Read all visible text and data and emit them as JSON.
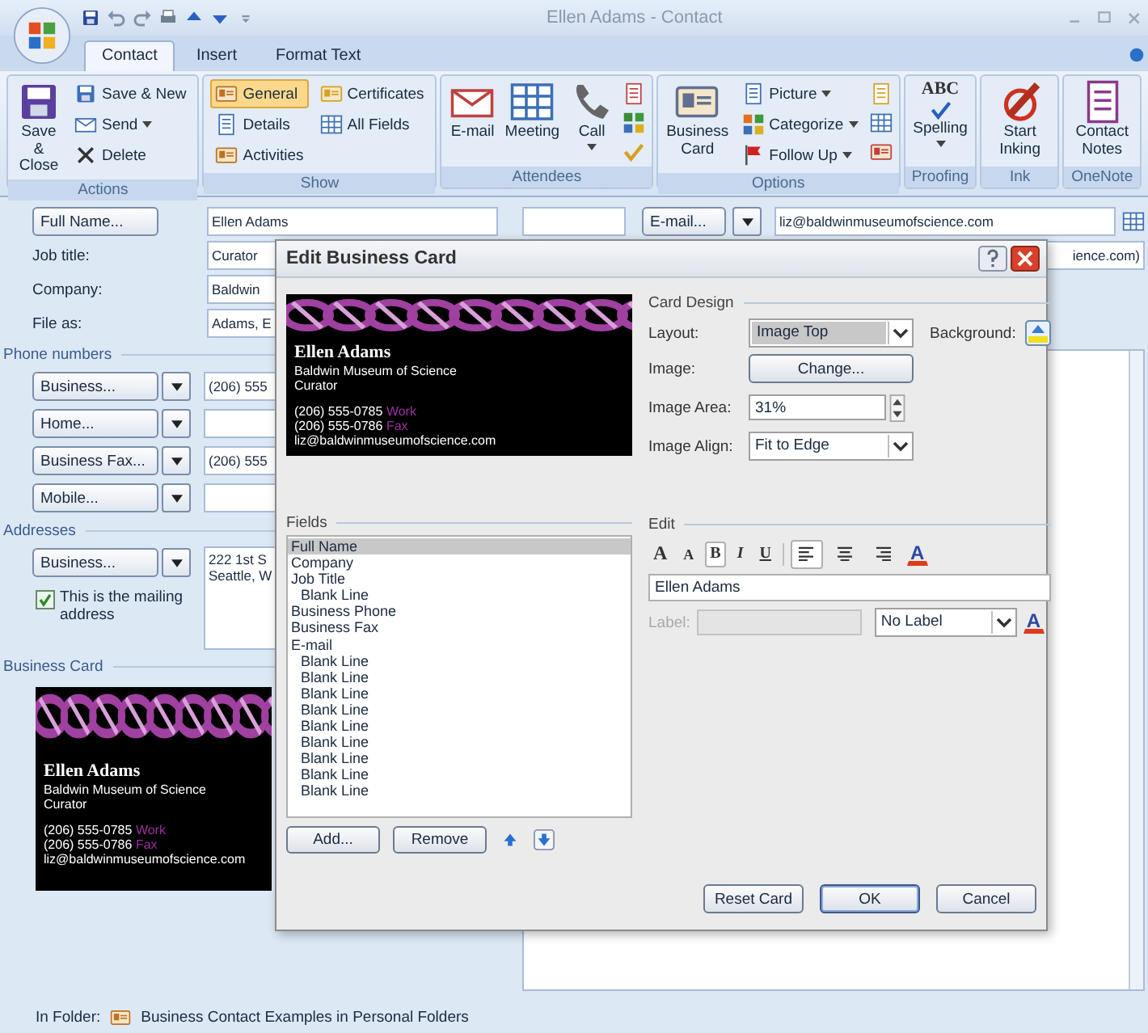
{
  "window": {
    "title": "Ellen Adams - Contact"
  },
  "tabs": [
    {
      "label": "Contact",
      "selected": true
    },
    {
      "label": "Insert",
      "selected": false
    },
    {
      "label": "Format Text",
      "selected": false
    }
  ],
  "ribbon": {
    "groups": [
      {
        "label": "Actions",
        "columns": [
          {
            "kind": "large",
            "items": [
              {
                "label": "Save & Close",
                "dropdown": false
              }
            ]
          },
          {
            "kind": "stack",
            "items": [
              {
                "label": "Save & New",
                "dropdown": false
              },
              {
                "label": "Send",
                "dropdown": true
              },
              {
                "label": "Delete",
                "dropdown": false
              }
            ]
          }
        ]
      },
      {
        "label": "Show",
        "columns": [
          {
            "kind": "stack",
            "items": [
              {
                "label": "General",
                "dropdown": false,
                "selected": true
              },
              {
                "label": "Details",
                "dropdown": false,
                "selected": false
              },
              {
                "label": "Activities",
                "dropdown": false,
                "selected": false
              }
            ]
          },
          {
            "kind": "stack",
            "items": [
              {
                "label": "Certificates",
                "dropdown": false,
                "selected": false
              },
              {
                "label": "All Fields",
                "dropdown": false,
                "selected": false
              }
            ]
          }
        ]
      },
      {
        "label": "Attendees",
        "columns": [
          {
            "kind": "large",
            "items": [
              {
                "label": "E-mail",
                "dropdown": false
              }
            ]
          },
          {
            "kind": "large",
            "items": [
              {
                "label": "Meeting",
                "dropdown": false
              }
            ]
          },
          {
            "kind": "large",
            "items": [
              {
                "label": "Call",
                "dropdown": true
              }
            ]
          },
          {
            "kind": "icons"
          }
        ]
      },
      {
        "label": "Options",
        "columns": [
          {
            "kind": "large",
            "items": [
              {
                "label": "Business Card",
                "dropdown": false
              }
            ]
          },
          {
            "kind": "stack",
            "items": [
              {
                "label": "Picture",
                "dropdown": true
              },
              {
                "label": "Categorize",
                "dropdown": true
              },
              {
                "label": "Follow Up",
                "dropdown": true
              }
            ]
          },
          {
            "kind": "icons"
          }
        ]
      },
      {
        "label": "Proofing",
        "columns": [
          {
            "kind": "large",
            "items": [
              {
                "label": "Spelling",
                "dropdown": true,
                "icon_text": "ABC"
              }
            ]
          }
        ]
      },
      {
        "label": "Ink",
        "columns": [
          {
            "kind": "large",
            "items": [
              {
                "label": "Start Inking",
                "dropdown": false
              }
            ]
          }
        ]
      },
      {
        "label": "OneNote",
        "columns": [
          {
            "kind": "large",
            "items": [
              {
                "label": "Contact Notes",
                "dropdown": false
              }
            ]
          }
        ]
      }
    ]
  },
  "contact_form": {
    "name_button": "Full Name...",
    "name_value": "Ellen Adams",
    "fields": [
      {
        "label": "Job title:",
        "value": "Curator"
      },
      {
        "label": "Company:",
        "value": "Baldwin"
      },
      {
        "label": "File as:",
        "value": "Adams, E"
      }
    ],
    "phone_heading": "Phone numbers",
    "phones": [
      {
        "button": "Business...",
        "value": "(206) 555"
      },
      {
        "button": "Home..."
      },
      {
        "button": "Business Fax...",
        "value": "(206) 555"
      },
      {
        "button": "Mobile..."
      }
    ],
    "addresses_heading": "Addresses",
    "address_button": "Business...",
    "address_lines": [
      "222 1st S",
      "Seattle, W"
    ],
    "mailing_checkbox": {
      "label": "This is the mailing address",
      "checked": true
    },
    "card_heading": "Business Card",
    "card": {
      "name": "Ellen Adams",
      "company": "Baldwin Museum of Science",
      "title": "Curator",
      "phones": [
        {
          "number": "(206) 555-0785",
          "label": "Work"
        },
        {
          "number": "(206) 555-0786",
          "label": "Fax"
        }
      ],
      "email": "liz@baldwinmuseumofscience.com"
    },
    "email_button": "E-mail...",
    "email_value": "liz@baldwinmuseumofscience.com",
    "display_as": "ience.com)"
  },
  "dialog": {
    "title": "Edit Business Card",
    "card": {
      "name": "Ellen Adams",
      "company": "Baldwin Museum of Science",
      "title": "Curator",
      "phones": [
        {
          "number": "(206) 555-0785",
          "label": "Work"
        },
        {
          "number": "(206) 555-0786",
          "label": "Fax"
        }
      ],
      "email": "liz@baldwinmuseumofscience.com"
    },
    "card_design_heading": "Card Design",
    "layout_label": "Layout:",
    "layout_value": "Image Top",
    "background_label": "Background:",
    "image_label": "Image:",
    "change_button": "Change...",
    "image_area_label": "Image Area:",
    "image_area_value": "31%",
    "image_align_label": "Image Align:",
    "image_align_value": "Fit to Edge",
    "fields_heading": "Fields",
    "fields": [
      {
        "label": "Full Name",
        "selected": true
      },
      {
        "label": "Company",
        "selected": false
      },
      {
        "label": "Job Title",
        "selected": false,
        "children": [
          {
            "label": "Blank Line",
            "selected": false
          }
        ]
      },
      {
        "label": "Business Phone",
        "selected": false
      },
      {
        "label": "Business Fax",
        "selected": false
      },
      {
        "label": "E-mail",
        "selected": false,
        "children": [
          {
            "label": "Blank Line",
            "selected": false
          },
          {
            "label": "Blank Line",
            "selected": false
          },
          {
            "label": "Blank Line",
            "selected": false
          },
          {
            "label": "Blank Line",
            "selected": false
          },
          {
            "label": "Blank Line",
            "selected": false
          },
          {
            "label": "Blank Line",
            "selected": false
          },
          {
            "label": "Blank Line",
            "selected": false
          },
          {
            "label": "Blank Line",
            "selected": false
          },
          {
            "label": "Blank Line",
            "selected": false
          }
        ]
      }
    ],
    "add_button": "Add...",
    "remove_button": "Remove",
    "edit_heading": "Edit",
    "font_size_buttons": [
      "A",
      "A"
    ],
    "style_buttons": [
      {
        "label": "B",
        "selected": true
      },
      {
        "label": "I",
        "selected": false
      },
      {
        "label": "U",
        "selected": false
      }
    ],
    "align_buttons": [
      {
        "selected": true
      },
      {
        "selected": false
      },
      {
        "selected": false
      }
    ],
    "font_color_button": "A",
    "edit_value": "Ellen Adams",
    "label_label": "Label:",
    "label_disabled": true,
    "label_select": "No Label",
    "label_color_button": "A",
    "buttons": [
      "Reset Card",
      "OK",
      "Cancel"
    ]
  },
  "footer": {
    "label": "In Folder:",
    "folder": "Business Contact Examples in Personal Folders"
  }
}
